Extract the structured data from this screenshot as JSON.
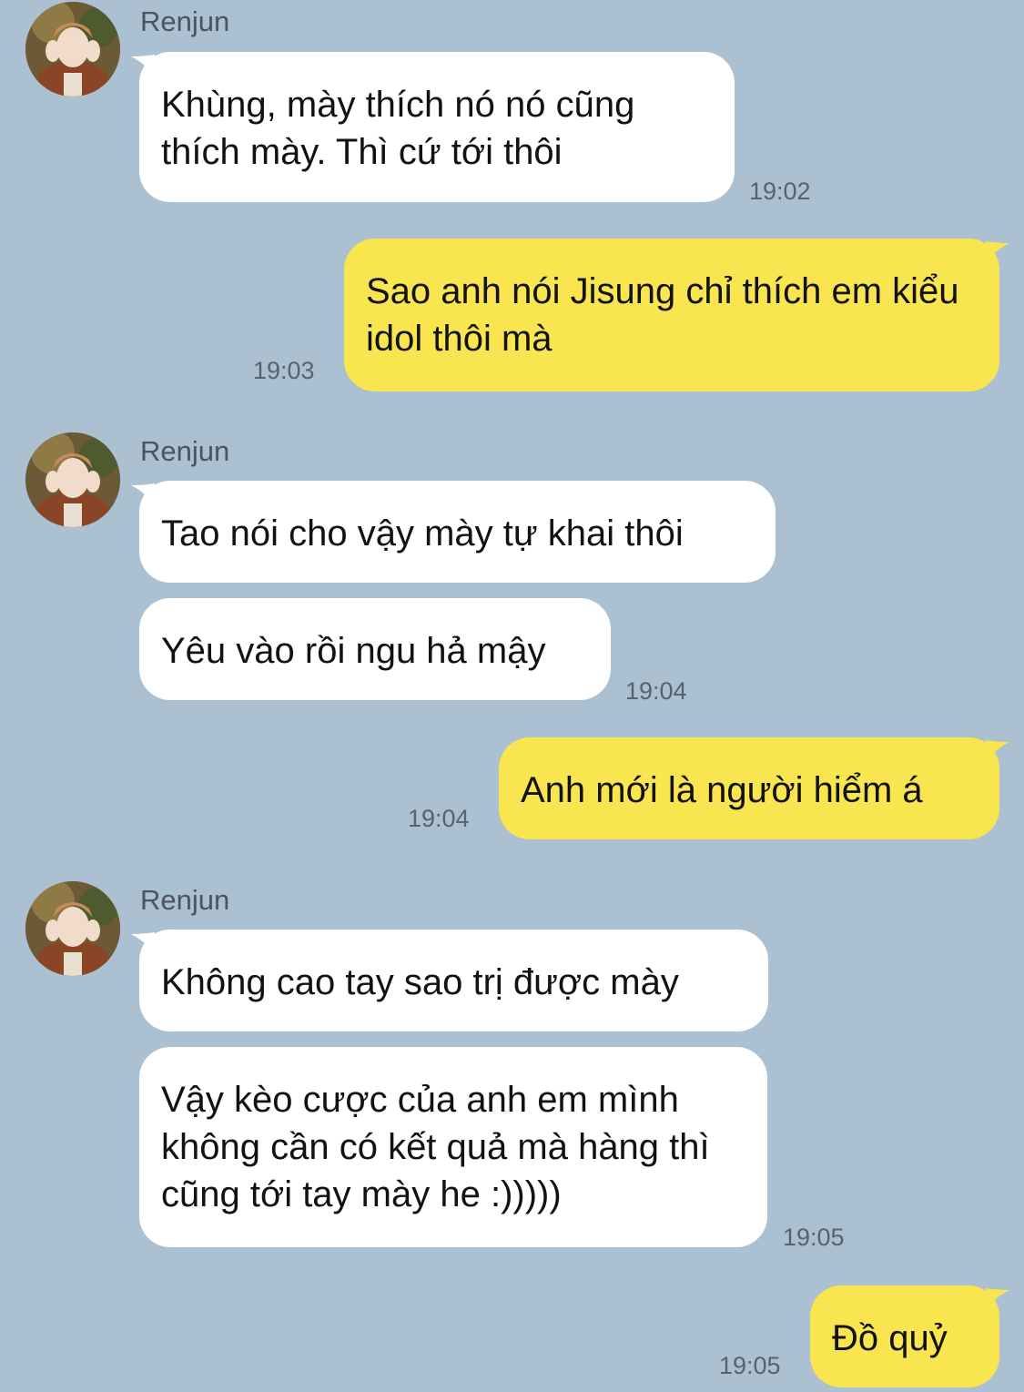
{
  "chat": {
    "sender_name": "Renjun",
    "messages": [
      {
        "direction": "in",
        "text": "Khùng, mày thích nó nó cũng thích mày. Thì cứ tới thôi",
        "time": "19:02"
      },
      {
        "direction": "out",
        "text": "Sao anh nói Jisung chỉ thích em kiểu idol thôi mà",
        "time": "19:03"
      },
      {
        "direction": "in",
        "text": "Tao nói cho vậy mày tự khai thôi",
        "time": ""
      },
      {
        "direction": "in",
        "text": "Yêu vào rồi ngu hả mậy",
        "time": "19:04"
      },
      {
        "direction": "out",
        "text": "Anh mới là người hiểm á",
        "time": "19:04"
      },
      {
        "direction": "in",
        "text": "Không cao tay sao trị được mày",
        "time": ""
      },
      {
        "direction": "in",
        "text": "Vậy kèo cược của anh em mình không cần có kết quả mà hàng thì cũng tới tay mày he :)))))",
        "time": "19:05"
      },
      {
        "direction": "out",
        "text": "Đồ quỷ",
        "time": "19:05"
      }
    ]
  },
  "colors": {
    "background": "#abc1d1",
    "incoming_bubble": "#ffffff",
    "outgoing_bubble": "#f9e54f"
  },
  "icons": {
    "avatar": "avatar-icon"
  }
}
